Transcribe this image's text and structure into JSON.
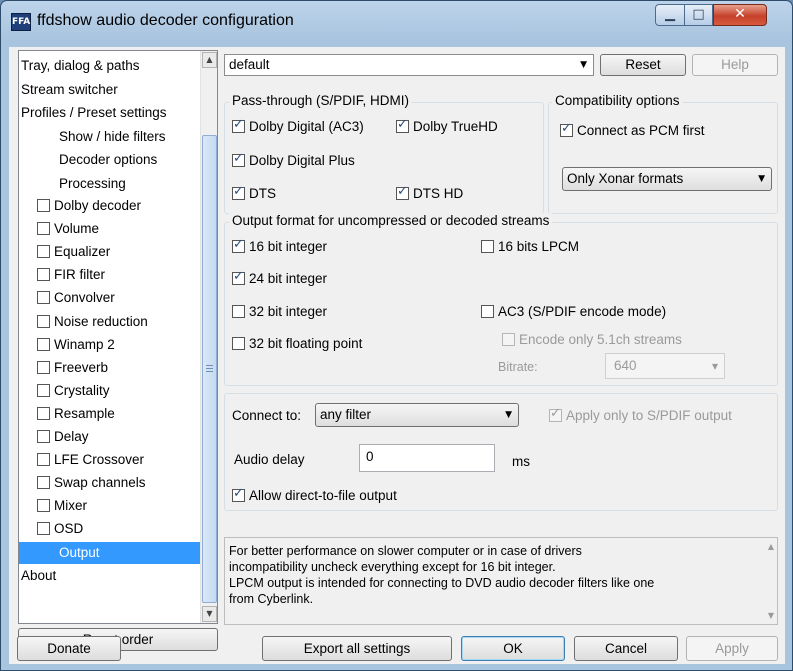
{
  "window": {
    "title": "ffdshow audio decoder configuration",
    "icon_text": "FFA",
    "minimize_glyph": "▁",
    "maximize_glyph": "□",
    "close_glyph": "✕"
  },
  "sidebar": {
    "items": [
      {
        "label": "Tray, dialog & paths",
        "checkbox": false
      },
      {
        "label": "Stream switcher",
        "checkbox": false
      },
      {
        "label": "Profiles / Preset settings",
        "checkbox": false
      },
      {
        "label": "Show / hide filters",
        "checkbox": false
      },
      {
        "label": "Decoder options",
        "checkbox": false
      },
      {
        "label": "Processing",
        "checkbox": false
      },
      {
        "label": "Dolby decoder",
        "checkbox": true,
        "checked": false
      },
      {
        "label": "Volume",
        "checkbox": true,
        "checked": false
      },
      {
        "label": "Equalizer",
        "checkbox": true,
        "checked": false
      },
      {
        "label": "FIR filter",
        "checkbox": true,
        "checked": false
      },
      {
        "label": "Convolver",
        "checkbox": true,
        "checked": false
      },
      {
        "label": "Noise reduction",
        "checkbox": true,
        "checked": false
      },
      {
        "label": "Winamp 2",
        "checkbox": true,
        "checked": false
      },
      {
        "label": "Freeverb",
        "checkbox": true,
        "checked": false
      },
      {
        "label": "Crystality",
        "checkbox": true,
        "checked": false
      },
      {
        "label": "Resample",
        "checkbox": true,
        "checked": false
      },
      {
        "label": "Delay",
        "checkbox": true,
        "checked": false
      },
      {
        "label": "LFE Crossover",
        "checkbox": true,
        "checked": false
      },
      {
        "label": "Swap channels",
        "checkbox": true,
        "checked": false
      },
      {
        "label": "Mixer",
        "checkbox": true,
        "checked": false
      },
      {
        "label": "OSD",
        "checkbox": true,
        "checked": false
      },
      {
        "label": "Output",
        "checkbox": false,
        "selected": true
      },
      {
        "label": "About",
        "checkbox": false
      }
    ],
    "reset_order_label": "Reset order"
  },
  "preset": {
    "value": "default",
    "reset_label": "Reset",
    "help_label": "Help"
  },
  "passthrough": {
    "title": "Pass-through (S/PDIF, HDMI)",
    "ac3": {
      "label": "Dolby Digital (AC3)",
      "checked": true
    },
    "truehd": {
      "label": "Dolby TrueHD",
      "checked": true
    },
    "ddplus": {
      "label": "Dolby Digital Plus",
      "checked": true
    },
    "dts": {
      "label": "DTS",
      "checked": true
    },
    "dtshd": {
      "label": "DTS HD",
      "checked": true
    }
  },
  "compat": {
    "title": "Compatibility options",
    "pcm_first": {
      "label": "Connect as PCM first",
      "checked": true
    },
    "formats_value": "Only Xonar formats"
  },
  "outformat": {
    "title": "Output format for uncompressed or decoded streams",
    "b16": {
      "label": "16 bit integer",
      "checked": true
    },
    "lpcm16": {
      "label": "16 bits LPCM",
      "checked": false
    },
    "b24": {
      "label": "24 bit integer",
      "checked": true
    },
    "b32": {
      "label": "32 bit integer",
      "checked": false
    },
    "ac3enc": {
      "label": "AC3 (S/PDIF encode mode)",
      "checked": false
    },
    "b32f": {
      "label": "32 bit floating point",
      "checked": false
    },
    "encode51": {
      "label": "Encode only 5.1ch streams",
      "checked": false
    },
    "bitrate_label": "Bitrate:",
    "bitrate_value": "640"
  },
  "connect": {
    "label": "Connect to:",
    "value": "any filter",
    "apply_spdif": {
      "label": "Apply only to S/PDIF output",
      "checked": true
    },
    "delay_label": "Audio delay",
    "delay_value": "0",
    "delay_unit": "ms",
    "direct_file": {
      "label": "Allow direct-to-file output",
      "checked": true
    }
  },
  "info": {
    "lines": [
      "For better performance on slower computer or in case of drivers",
      "incompatibility uncheck everything except for 16 bit integer.",
      "LPCM output is intended for connecting to DVD audio decoder filters like one",
      "from Cyberlink."
    ]
  },
  "footer": {
    "donate": "Donate",
    "export": "Export all settings",
    "ok": "OK",
    "cancel": "Cancel",
    "apply": "Apply"
  },
  "glyphs": {
    "down_arrow": "▼",
    "up_arrow": "▲",
    "small_down": "▾",
    "grip": "≡"
  }
}
